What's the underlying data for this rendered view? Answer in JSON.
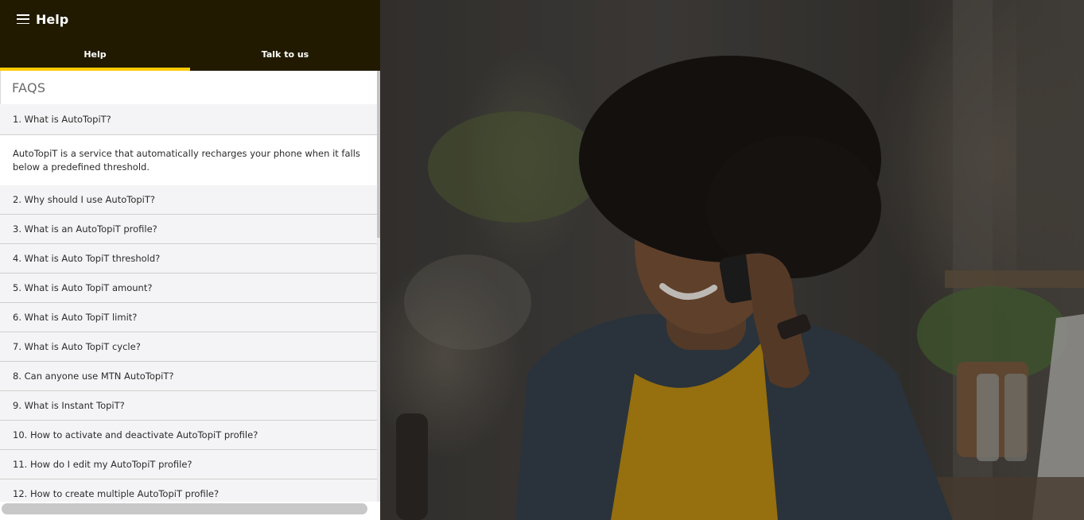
{
  "header": {
    "menu_icon": "hamburger-menu-icon",
    "title": "Help"
  },
  "tabs": [
    {
      "label": "Help",
      "active": true
    },
    {
      "label": "Talk to us",
      "active": false
    }
  ],
  "colors": {
    "header_bg": "#211a00",
    "accent": "#ffcb05"
  },
  "faqs": {
    "heading": "FAQS",
    "items": [
      {
        "question": "1. What is AutoTopiT?",
        "answer": "AutoTopiT is a service that automatically recharges your phone when it falls below a predefined threshold.",
        "expanded": true
      },
      {
        "question": "2. Why should I use AutoTopiT?"
      },
      {
        "question": "3. What is an AutoTopiT profile?"
      },
      {
        "question": "4. What is Auto TopiT threshold?"
      },
      {
        "question": "5. What is Auto TopiT amount?"
      },
      {
        "question": "6. What is Auto TopiT limit?"
      },
      {
        "question": "7. What is Auto TopiT cycle?"
      },
      {
        "question": "8. Can anyone use MTN AutoTopiT?"
      },
      {
        "question": "9. What is Instant TopiT?"
      },
      {
        "question": "10. How to activate and deactivate AutoTopiT profile?"
      },
      {
        "question": "11. How do I edit my AutoTopiT profile?"
      },
      {
        "question": "12. How to create multiple AutoTopiT profile?"
      }
    ]
  }
}
